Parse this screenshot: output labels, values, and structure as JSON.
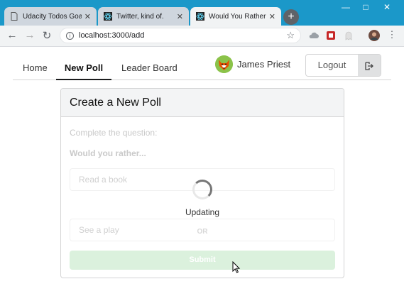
{
  "browser": {
    "tabs": [
      {
        "title": "Udacity Todos Goals",
        "icon": "document-icon",
        "active": false
      },
      {
        "title": "Twitter, kind of.",
        "icon": "react-icon",
        "active": false
      },
      {
        "title": "Would You Rather G",
        "icon": "react-icon",
        "active": true
      }
    ],
    "new_tab_label": "+",
    "address": "localhost:3000/add",
    "window_controls": {
      "minimize": "—",
      "maximize": "□",
      "close": "✕"
    }
  },
  "nav": {
    "home": "Home",
    "new_poll": "New Poll",
    "leader_board": "Leader Board",
    "user_name": "James Priest",
    "logout": "Logout"
  },
  "card": {
    "header": "Create a New Poll",
    "prompt": "Complete the question:",
    "would_you_rather": "Would you rather...",
    "option_one_placeholder": "Read a book",
    "or": "OR",
    "option_two_placeholder": "See a play",
    "submit": "Submit",
    "loader_text": "Updating"
  },
  "colors": {
    "chrome_tabbar": "#1b98c9",
    "submit_disabled": "#dbf1dd"
  }
}
